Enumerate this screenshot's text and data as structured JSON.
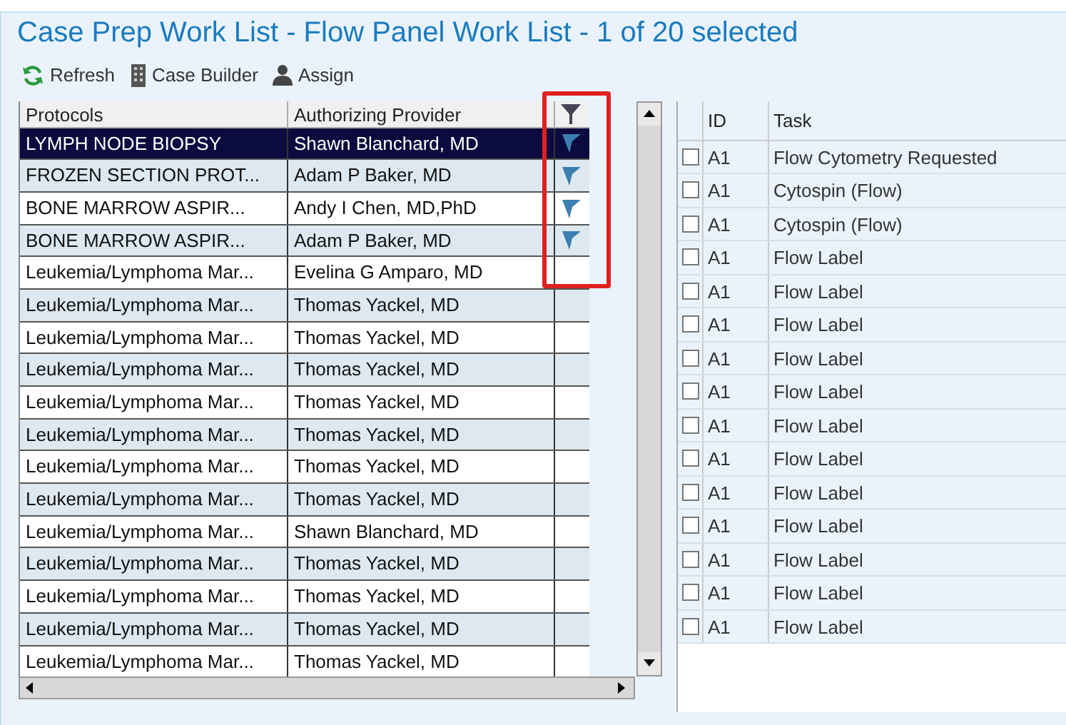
{
  "title": "Case Prep Work List - Flow Panel Work List - 1 of 20 selected",
  "toolbar": [
    {
      "kind": "refresh",
      "label": "Refresh"
    },
    {
      "kind": "builder",
      "label": "Case Builder"
    },
    {
      "kind": "assign",
      "label": "Assign"
    }
  ],
  "protocols_table": {
    "columns": [
      "Protocols",
      "Authorizing Provider"
    ],
    "rows": [
      {
        "protocol": "LYMPH NODE BIOPSY",
        "provider": "Shawn Blanchard, MD",
        "flagged": true,
        "selected": true
      },
      {
        "protocol": "FROZEN SECTION PROT...",
        "provider": "Adam P Baker, MD",
        "flagged": true,
        "selected": false
      },
      {
        "protocol": "BONE MARROW ASPIR...",
        "provider": "Andy I Chen, MD,PhD",
        "flagged": true,
        "selected": false
      },
      {
        "protocol": "BONE MARROW ASPIR...",
        "provider": "Adam P Baker, MD",
        "flagged": true,
        "selected": false
      },
      {
        "protocol": "Leukemia/Lymphoma Mar...",
        "provider": "Evelina G Amparo, MD",
        "flagged": false,
        "selected": false
      },
      {
        "protocol": "Leukemia/Lymphoma Mar...",
        "provider": "Thomas Yackel, MD",
        "flagged": false,
        "selected": false
      },
      {
        "protocol": "Leukemia/Lymphoma Mar...",
        "provider": "Thomas Yackel, MD",
        "flagged": false,
        "selected": false
      },
      {
        "protocol": "Leukemia/Lymphoma Mar...",
        "provider": "Thomas Yackel, MD",
        "flagged": false,
        "selected": false
      },
      {
        "protocol": "Leukemia/Lymphoma Mar...",
        "provider": "Thomas Yackel, MD",
        "flagged": false,
        "selected": false
      },
      {
        "protocol": "Leukemia/Lymphoma Mar...",
        "provider": "Thomas Yackel, MD",
        "flagged": false,
        "selected": false
      },
      {
        "protocol": "Leukemia/Lymphoma Mar...",
        "provider": "Thomas Yackel, MD",
        "flagged": false,
        "selected": false
      },
      {
        "protocol": "Leukemia/Lymphoma Mar...",
        "provider": "Thomas Yackel, MD",
        "flagged": false,
        "selected": false
      },
      {
        "protocol": "Leukemia/Lymphoma Mar...",
        "provider": "Shawn Blanchard, MD",
        "flagged": false,
        "selected": false
      },
      {
        "protocol": "Leukemia/Lymphoma Mar...",
        "provider": "Thomas Yackel, MD",
        "flagged": false,
        "selected": false
      },
      {
        "protocol": "Leukemia/Lymphoma Mar...",
        "provider": "Thomas Yackel, MD",
        "flagged": false,
        "selected": false
      },
      {
        "protocol": "Leukemia/Lymphoma Mar...",
        "provider": "Thomas Yackel, MD",
        "flagged": false,
        "selected": false
      },
      {
        "protocol": "Leukemia/Lymphoma Mar...",
        "provider": "Thomas Yackel, MD",
        "flagged": false,
        "selected": false
      }
    ]
  },
  "tasks_table": {
    "columns": [
      "ID",
      "Task"
    ],
    "rows": [
      {
        "id": "A1",
        "task": "Flow Cytometry Requested",
        "checked": false
      },
      {
        "id": "A1",
        "task": "Cytospin (Flow)",
        "checked": false
      },
      {
        "id": "A1",
        "task": "Cytospin (Flow)",
        "checked": false
      },
      {
        "id": "A1",
        "task": "Flow Label",
        "checked": false
      },
      {
        "id": "A1",
        "task": "Flow Label",
        "checked": false
      },
      {
        "id": "A1",
        "task": "Flow Label",
        "checked": false
      },
      {
        "id": "A1",
        "task": "Flow Label",
        "checked": false
      },
      {
        "id": "A1",
        "task": "Flow Label",
        "checked": false
      },
      {
        "id": "A1",
        "task": "Flow Label",
        "checked": false
      },
      {
        "id": "A1",
        "task": "Flow Label",
        "checked": false
      },
      {
        "id": "A1",
        "task": "Flow Label",
        "checked": false
      },
      {
        "id": "A1",
        "task": "Flow Label",
        "checked": false
      },
      {
        "id": "A1",
        "task": "Flow Label",
        "checked": false
      },
      {
        "id": "A1",
        "task": "Flow Label",
        "checked": false
      },
      {
        "id": "A1",
        "task": "Flow Label",
        "checked": false
      }
    ]
  }
}
